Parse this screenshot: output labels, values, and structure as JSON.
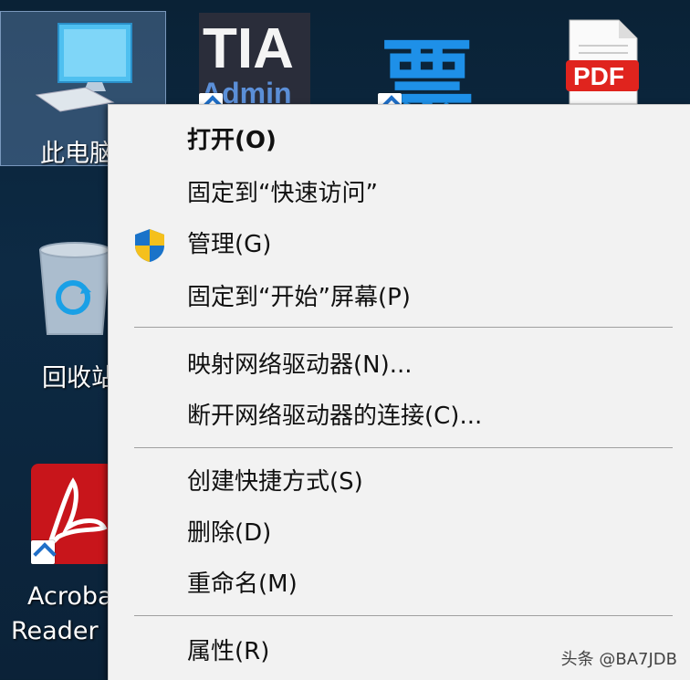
{
  "desktop": {
    "icons": [
      {
        "label": "此电脑"
      },
      {
        "label": "TIA Admin",
        "tile_text": "TIA",
        "tile_sub": "Admin"
      },
      {
        "label": "票",
        "tile_text": "票"
      },
      {
        "label": "PDF",
        "tile_text": "PDF"
      },
      {
        "label": "回收站"
      },
      {
        "label_line1": "Acrobat",
        "label_line2": "Reader"
      }
    ]
  },
  "context_menu": {
    "items": [
      {
        "label": "打开(O)",
        "bold": true
      },
      {
        "label": "固定到“快速访问”"
      },
      {
        "label": "管理(G)",
        "icon": "uac-shield-icon"
      },
      {
        "label": "固定到“开始”屏幕(P)"
      },
      {
        "label": "映射网络驱动器(N)..."
      },
      {
        "label": "断开网络驱动器的连接(C)..."
      },
      {
        "label": "创建快捷方式(S)"
      },
      {
        "label": "删除(D)"
      },
      {
        "label": "重命名(M)"
      },
      {
        "label": "属性(R)"
      }
    ]
  },
  "watermark": "头条 @BA7JDB",
  "colors": {
    "desktop_bg": "#0d2a44",
    "menu_bg": "#f2f2f2",
    "acrobat_red": "#c8151b",
    "pdf_red": "#e0241e",
    "shield_blue": "#1a73c9",
    "shield_yellow": "#f5c01c"
  }
}
